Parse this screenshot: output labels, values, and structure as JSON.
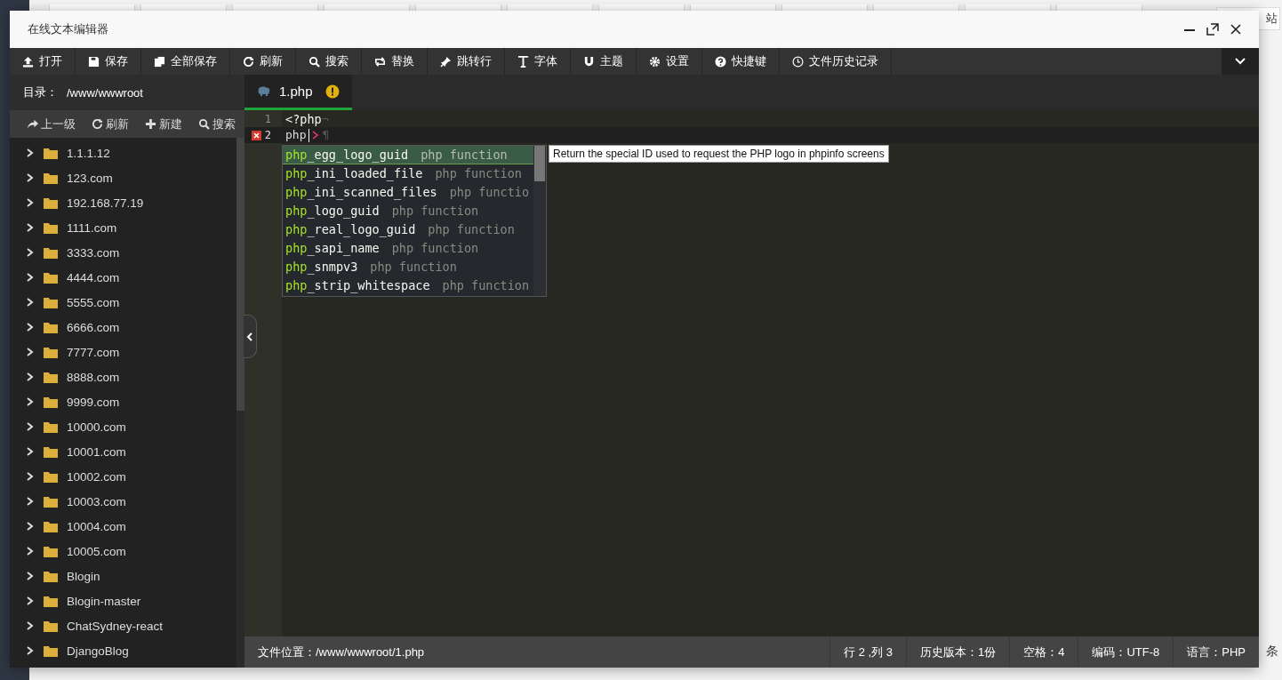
{
  "background": {
    "fragments": [
      "站",
      "条"
    ]
  },
  "window": {
    "title": "在线文本编辑器"
  },
  "toolbar": [
    "打开",
    "保存",
    "全部保存",
    "刷新",
    "搜索",
    "替换",
    "跳转行",
    "字体",
    "主题",
    "设置",
    "快捷键",
    "文件历史记录"
  ],
  "sidebar": {
    "directory_label": "目录：",
    "directory": "/www/wwwroot",
    "actions": [
      "上一级",
      "刷新",
      "新建",
      "搜索"
    ],
    "items": [
      {
        "name": "1.1.1.12",
        "expanded": false
      },
      {
        "name": "123.com",
        "expanded": false
      },
      {
        "name": "192.168.77.19",
        "expanded": false
      },
      {
        "name": "1111.com",
        "expanded": false
      },
      {
        "name": "3333.com",
        "expanded": false
      },
      {
        "name": "4444.com",
        "expanded": false
      },
      {
        "name": "5555.com",
        "expanded": false
      },
      {
        "name": "6666.com",
        "expanded": false
      },
      {
        "name": "7777.com",
        "expanded": false
      },
      {
        "name": "8888.com",
        "expanded": false
      },
      {
        "name": "9999.com",
        "expanded": false
      },
      {
        "name": "10000.com",
        "expanded": false
      },
      {
        "name": "10001.com",
        "expanded": false
      },
      {
        "name": "10002.com",
        "expanded": false
      },
      {
        "name": "10003.com",
        "expanded": false
      },
      {
        "name": "10004.com",
        "expanded": false
      },
      {
        "name": "10005.com",
        "expanded": false
      },
      {
        "name": "Blogin",
        "expanded": false
      },
      {
        "name": "Blogin-master",
        "expanded": false
      },
      {
        "name": "ChatSydney-react",
        "expanded": false
      },
      {
        "name": "DjangoBlog",
        "expanded": false
      }
    ]
  },
  "editor": {
    "tabs": [
      {
        "label": "1.php",
        "selected": true
      }
    ],
    "lines": [
      {
        "number": "1",
        "text": "<?php",
        "eol": "¬",
        "error": false,
        "active": false
      },
      {
        "number": "2",
        "text": "php",
        "eol": "¶",
        "error": true,
        "active": true
      }
    ],
    "autocomplete": {
      "items": [
        {
          "prefix": "php",
          "rest": "_egg_logo_guid",
          "meta": "php function",
          "selected": true
        },
        {
          "prefix": "php",
          "rest": "_ini_loaded_file",
          "meta": "php function",
          "selected": false
        },
        {
          "prefix": "php",
          "rest": "_ini_scanned_files",
          "meta": "php functio",
          "selected": false
        },
        {
          "prefix": "php",
          "rest": "_logo_guid",
          "meta": "php function",
          "selected": false
        },
        {
          "prefix": "php",
          "rest": "_real_logo_guid",
          "meta": "php function",
          "selected": false
        },
        {
          "prefix": "php",
          "rest": "_sapi_name",
          "meta": "php function",
          "selected": false
        },
        {
          "prefix": "php",
          "rest": "_snmpv3",
          "meta": "php function",
          "selected": false
        },
        {
          "prefix": "php",
          "rest": "_strip_whitespace",
          "meta": "php function",
          "selected": false
        }
      ],
      "tooltip": "Return the special ID used to request the PHP logo in phpinfo screens"
    }
  },
  "status_bar": {
    "path": "文件位置：/www/wwwroot/1.php",
    "items": [
      "行 2 ,列 3",
      "历史版本：1份",
      "空格：4",
      "编码：UTF-8",
      "语言：PHP"
    ]
  }
}
